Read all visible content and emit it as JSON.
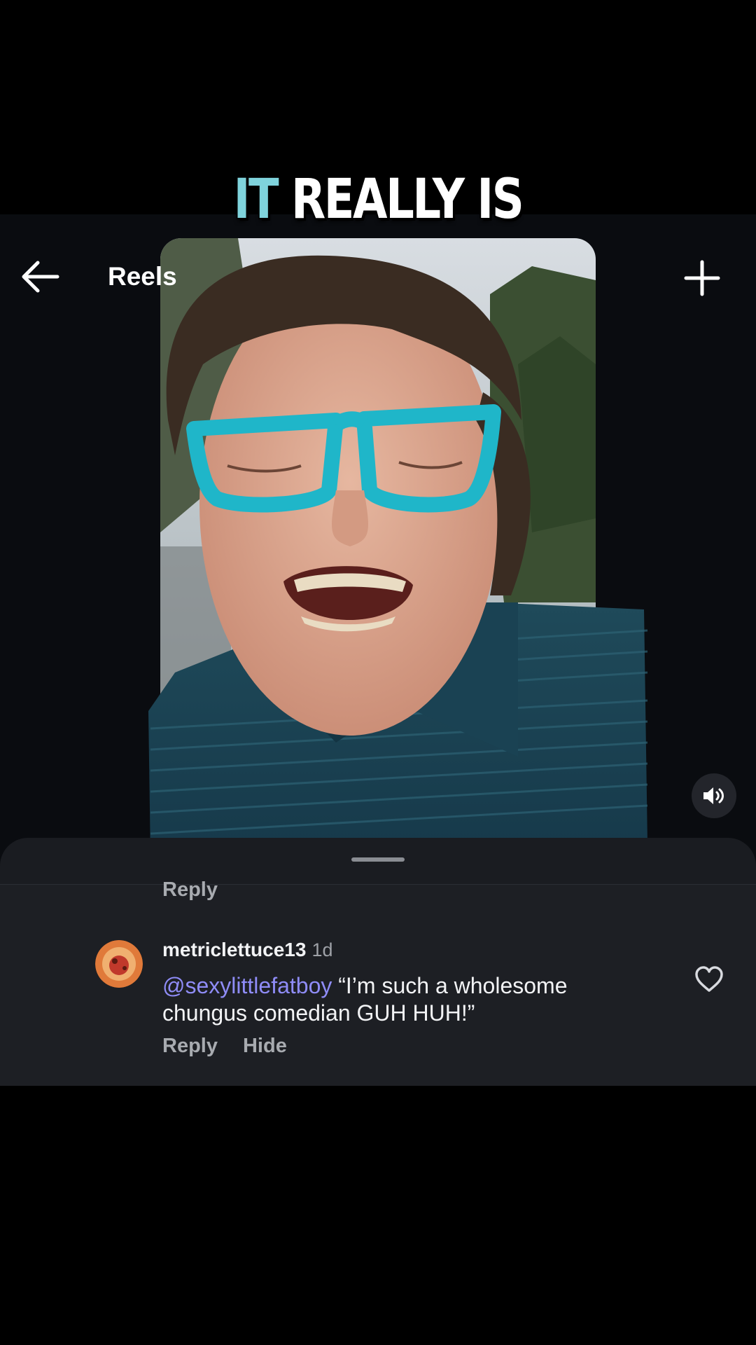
{
  "overlay_caption": {
    "highlight": "IT",
    "rest": "REALLY IS"
  },
  "header": {
    "title": "Reels",
    "back_icon": "arrow-left-icon",
    "create_icon": "plus-icon"
  },
  "video": {
    "sound_icon": "speaker-on-icon"
  },
  "comments": {
    "previous_comment_action": "Reply",
    "comment": {
      "username": "metriclettuce13",
      "timestamp": "1d",
      "mention": "@sexylittlefatboy",
      "text": " “I’m such a wholesome chungus comedian GUH HUH!”",
      "reply_label": "Reply",
      "hide_label": "Hide",
      "like_icon": "heart-outline-icon"
    }
  },
  "colors": {
    "caption_highlight": "#7fd3dc",
    "mention": "#8f8cf7",
    "sheet": "#1d1f24"
  }
}
